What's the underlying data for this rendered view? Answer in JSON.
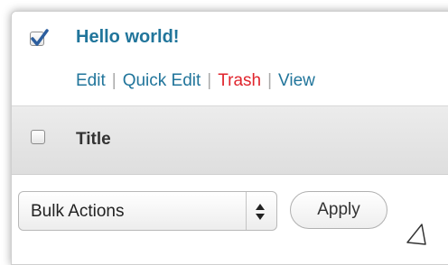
{
  "post": {
    "checked": true,
    "title": "Hello world!",
    "actions": {
      "edit": "Edit",
      "quick_edit": "Quick Edit",
      "trash": "Trash",
      "view": "View",
      "separator": "|"
    }
  },
  "table_header": {
    "title_column": "Title"
  },
  "bulk": {
    "selected": "Bulk Actions",
    "apply_label": "Apply"
  },
  "colors": {
    "link": "#21759b",
    "trash": "#e0252d",
    "checkmark": "#2c5e9e"
  },
  "icons": {
    "checkbox_checked": "checkmark-icon",
    "select_arrows": "up-down-arrows-icon",
    "cursor": "cursor-arrow-icon"
  }
}
